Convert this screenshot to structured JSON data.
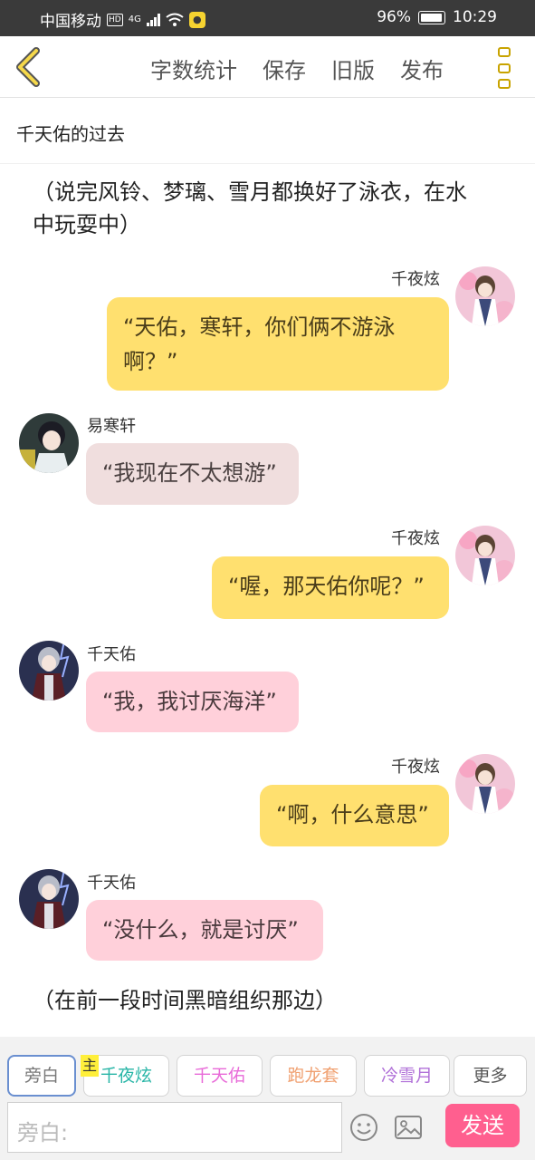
{
  "status_bar": {
    "carrier": "中国移动",
    "network": "4G",
    "battery": "96%",
    "time": "10:29"
  },
  "nav": {
    "actions": [
      "字数统计",
      "保存",
      "旧版",
      "发布"
    ]
  },
  "story_title": "千天佑的过去",
  "messages": [
    {
      "type": "narration",
      "text": "（说完风铃、梦璃、雪月都换好了泳衣，在水中玩耍中）"
    },
    {
      "type": "right",
      "name": "千夜炫",
      "text": "“天佑，寒轩，你们俩不游泳啊？”"
    },
    {
      "type": "left",
      "name": "易寒轩",
      "text": "“我现在不太想游”"
    },
    {
      "type": "right",
      "name": "千夜炫",
      "text": "“喔，那天佑你呢？”"
    },
    {
      "type": "left",
      "name": "千天佑",
      "text": "“我，我讨厌海洋”"
    },
    {
      "type": "right",
      "name": "千夜炫",
      "text": "“啊，什么意思”"
    },
    {
      "type": "left",
      "name": "千天佑",
      "text": "“没什么，就是讨厌”"
    },
    {
      "type": "narration",
      "text": "（在前一段时间黑暗组织那边）"
    }
  ],
  "narration_lines": {
    "first_line1": "（说完风铃、梦璃、雪月都换好了泳衣，在水",
    "first_line2": "中玩耍中）",
    "last": "（在前一段时间黑暗组织那边）"
  },
  "bubble_lines": {
    "b1_line1": "“天佑，寒轩，你们俩不游泳",
    "b1_line2": "啊？”"
  },
  "roles": {
    "main_tag": "主",
    "items": [
      {
        "label": "旁白",
        "color": "#777777"
      },
      {
        "label": "千夜炫",
        "color": "#27b5a6"
      },
      {
        "label": "千天佑",
        "color": "#e86ad8"
      },
      {
        "label": "跑龙套",
        "color": "#f0a070"
      },
      {
        "label": "冷雪月",
        "color": "#b070d8"
      },
      {
        "label": "更多",
        "color": "#555555"
      }
    ]
  },
  "composer": {
    "placeholder": "旁白:",
    "send_label": "发送"
  },
  "colors": {
    "accent_yellow": "#ffe06f",
    "send_pink": "#ff5f8f",
    "bubble_pink": "#ffd0da",
    "bubble_tan": "#f0dede"
  }
}
